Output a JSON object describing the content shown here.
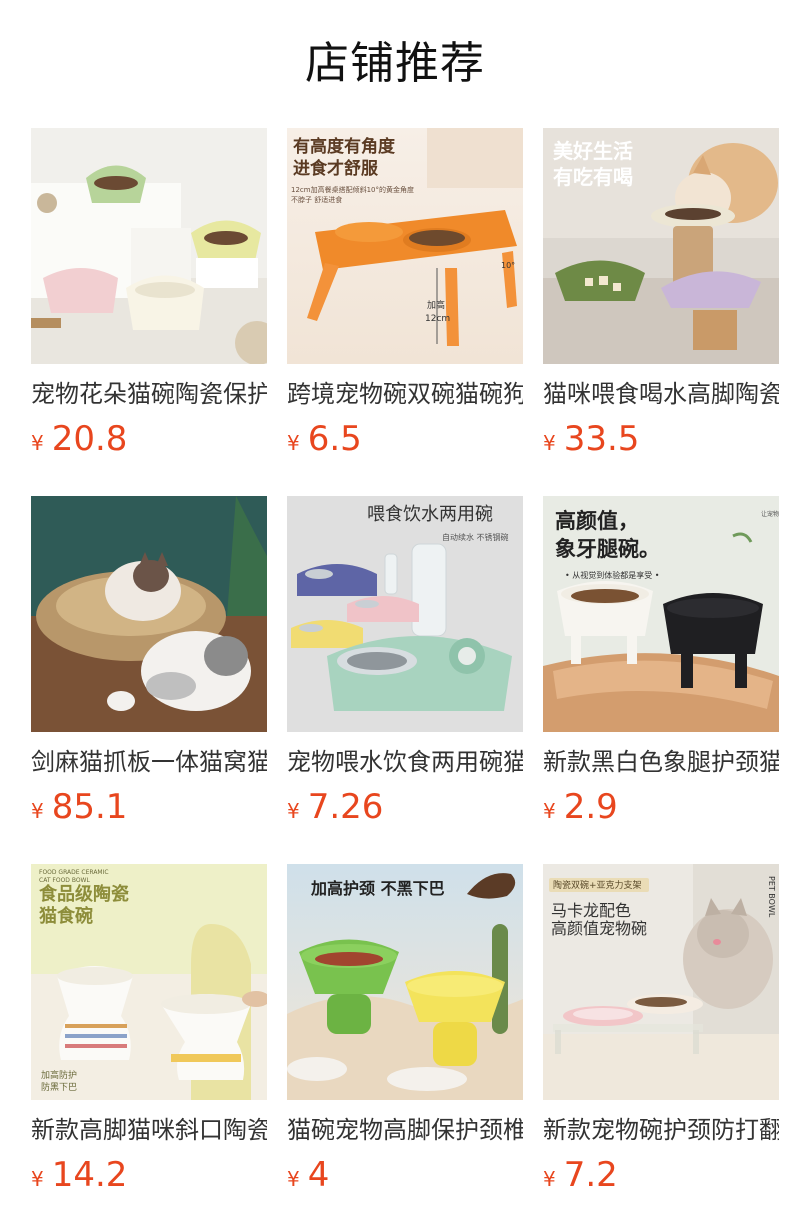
{
  "page": {
    "title": "店铺推荐"
  },
  "currency_symbol": "¥",
  "products": [
    {
      "name": "宠物花朵猫碗陶瓷保护颈椎",
      "price": "20.8",
      "image": {
        "icon": "cat-bowl-flower-photo",
        "caption": "",
        "sub": ""
      }
    },
    {
      "name": "跨境宠物碗双碗猫碗狗碗",
      "price": "6.5",
      "image": {
        "icon": "cat-bowl-double-orange-photo",
        "caption": "有高度有角度\n进食才舒服",
        "sub": "12cm加高餐桌搭配倾斜10°的黄金角度\n不脖子 舒适进食",
        "height_note": "加高\n12cm",
        "angle_note": "10°"
      }
    },
    {
      "name": "猫咪喂食喝水高脚陶瓷碗",
      "price": "33.5",
      "image": {
        "icon": "cat-eating-photo",
        "caption": "美好生活\n有吃有喝",
        "sub": ""
      }
    },
    {
      "name": "剑麻猫抓板一体猫窝猫碗",
      "price": "85.1",
      "image": {
        "icon": "sisal-cat-bed-photo",
        "caption": "",
        "sub": ""
      }
    },
    {
      "name": "宠物喂水饮食两用碗猫碗",
      "price": "7.26",
      "image": {
        "icon": "water-feeder-bowl-photo",
        "caption": "喂食饮水两用碗",
        "sub": "自动续水 不锈钢碗"
      }
    },
    {
      "name": "新款黑白色象腿护颈猫碗",
      "price": "2.9",
      "image": {
        "icon": "elephant-leg-bowl-photo",
        "caption": "高颜值，\n象牙腿碗。",
        "sub": "• 从视觉到体验都是享受 •",
        "side": "让宠物吃饭"
      }
    },
    {
      "name": "新款高脚猫咪斜口陶瓷碗",
      "price": "14.2",
      "image": {
        "icon": "ceramic-tall-bowl-photo",
        "caption": "食品级陶瓷\n猫食碗",
        "sub": "FOOD GRADE CERAMIC\nCAT FOOD BOWL",
        "note": "加高防护\n防黑下巴"
      }
    },
    {
      "name": "猫碗宠物高脚保护颈椎碗",
      "price": "4",
      "image": {
        "icon": "green-yellow-bowl-photo",
        "caption": "加高护颈 不黑下巴",
        "sub": ""
      }
    },
    {
      "name": "新款宠物碗护颈防打翻猫碗",
      "price": "7.2",
      "image": {
        "icon": "acrylic-stand-bowl-photo",
        "caption": "马卡龙配色\n高颜值宠物碗",
        "sub": "",
        "tag": "陶瓷双碗+亚克力支架",
        "side": "PET BOWL"
      }
    }
  ]
}
